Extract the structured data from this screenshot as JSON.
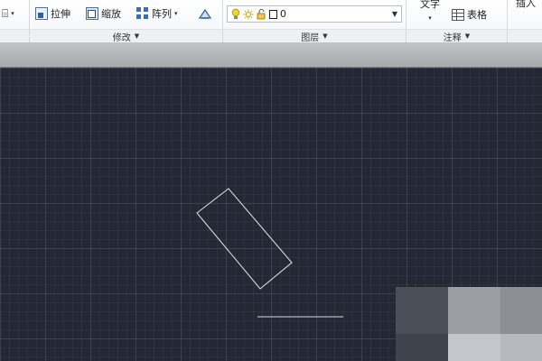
{
  "ribbon": {
    "modify": {
      "title": "修改",
      "stretch": "拉伸",
      "scale": "缩放",
      "array": "阵列"
    },
    "layers": {
      "title": "图层",
      "current_layer": "0"
    },
    "annotation": {
      "title": "注释",
      "text": "文字",
      "table": "表格"
    },
    "insert": {
      "label": "插入"
    }
  },
  "colors": {
    "canvas_bg": "#222834",
    "drawing_stroke": "#d8dbe0"
  },
  "icons": [
    "stretch-icon",
    "scale-icon",
    "array-icon",
    "match-properties-icon",
    "lightbulb-icon",
    "sun-icon",
    "lock-icon",
    "table-icon"
  ]
}
